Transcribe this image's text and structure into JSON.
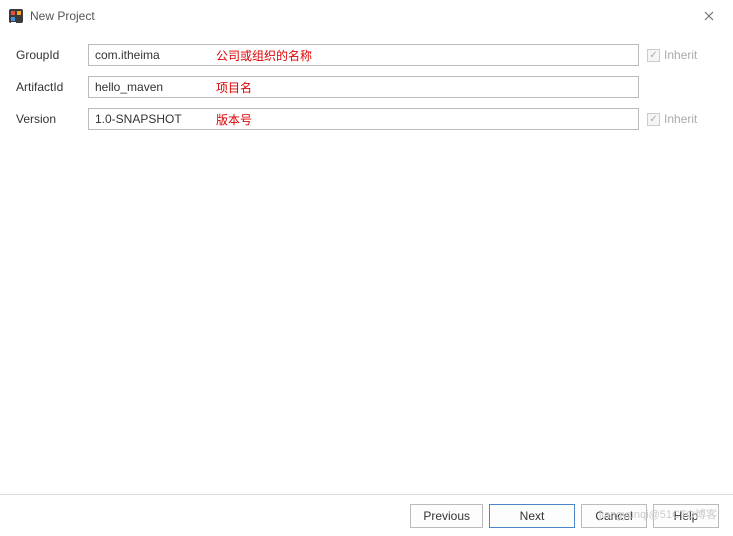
{
  "window": {
    "title": "New Project"
  },
  "form": {
    "groupId": {
      "label": "GroupId",
      "value": "com.itheima",
      "annotation": "公司或组织的名称",
      "inherit": "Inherit"
    },
    "artifactId": {
      "label": "ArtifactId",
      "value": "hello_maven",
      "annotation": "项目名"
    },
    "version": {
      "label": "Version",
      "value": "1.0-SNAPSHOT",
      "annotation": "版本号",
      "inherit": "Inherit"
    }
  },
  "buttons": {
    "previous": "Previous",
    "next": "Next",
    "cancel": "Cancel",
    "help": "Help"
  },
  "watermark": "jiangyunqi@51CTO博客"
}
